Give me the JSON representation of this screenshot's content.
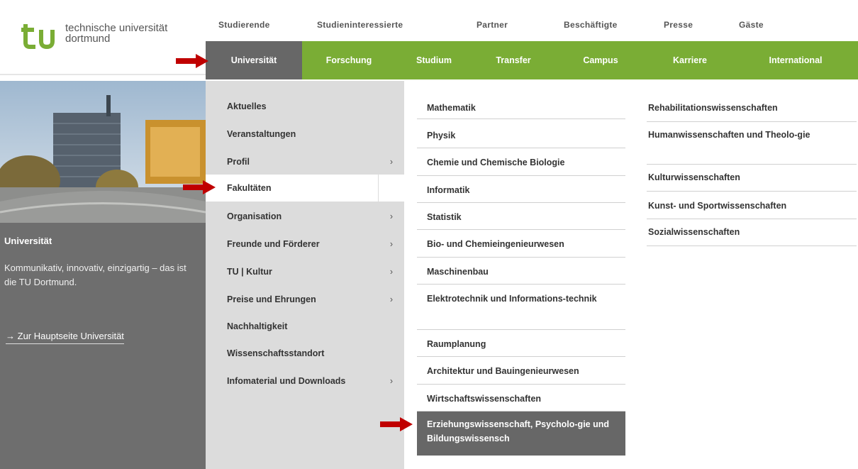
{
  "brand": {
    "line1": "technische universität",
    "line2": "dortmund"
  },
  "top_nav": [
    "Studierende",
    "Studieninteressierte",
    "Partner",
    "Beschäftigte",
    "Presse",
    "Gäste"
  ],
  "main_nav": [
    "Universität",
    "Forschung",
    "Studium",
    "Transfer",
    "Campus",
    "Karriere",
    "International"
  ],
  "left_panel": {
    "title": "Universität",
    "description": "Kommunikativ, innovativ, einzigartig – das ist die TU Dortmund.",
    "link": "Zur Hauptseite Universität"
  },
  "col1": [
    {
      "label": "Aktuelles"
    },
    {
      "label": "Veranstaltungen"
    },
    {
      "label": "Profil",
      "chev": "›"
    },
    {
      "label": "Fakultäten"
    },
    {
      "label": "Organisation",
      "chev": "›"
    },
    {
      "label": "Freunde und Förderer",
      "chev": "›"
    },
    {
      "label": "TU | Kultur",
      "chev": "›"
    },
    {
      "label": "Preise und Ehrungen",
      "chev": "›"
    },
    {
      "label": "Nachhaltigkeit"
    },
    {
      "label": "Wissenschaftsstandort"
    },
    {
      "label": "Infomaterial und Downloads",
      "chev": "›"
    }
  ],
  "col2": [
    "Mathematik",
    "Physik",
    "Chemie und Chemische Biologie",
    "Informatik",
    "Statistik",
    "Bio- und Chemieingenieurwesen",
    "Maschinenbau",
    "Elektrotechnik und Informations-technik",
    "Raumplanung",
    "Architektur und Bauingenieurwesen",
    "Wirtschaftswissenschaften",
    "Erziehungswissenschaft, Psycholo-gie und Bildungswissensch"
  ],
  "col3": [
    "Rehabilitationswissenschaften",
    "Humanwissenschaften und Theolo-gie",
    "Kulturwissenschaften",
    "Kunst- und Sportwissenschaften",
    "Sozialwissenschaften"
  ],
  "colors": {
    "green": "#7aad35",
    "gray": "#676767",
    "arrow": "#c00000"
  },
  "icons": {
    "arrow_right": "→",
    "chevron": "›"
  }
}
